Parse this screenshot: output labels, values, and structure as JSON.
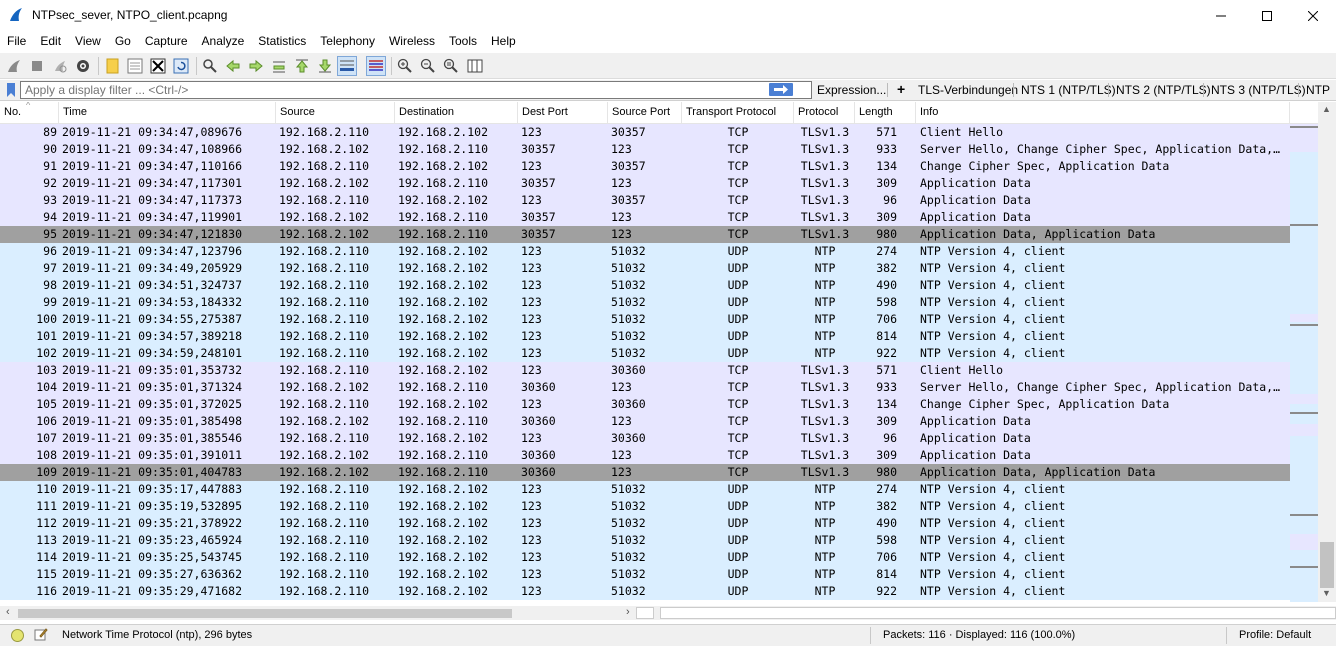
{
  "window": {
    "title": "NTPsec_sever, NTPO_client.pcapng"
  },
  "menu": [
    "File",
    "Edit",
    "View",
    "Go",
    "Capture",
    "Analyze",
    "Statistics",
    "Telephony",
    "Wireless",
    "Tools",
    "Help"
  ],
  "filter": {
    "placeholder": "Apply a display filter ... <Ctrl-/>",
    "expression_label": "Expression...",
    "buttons": [
      "TLS-Verbindungen",
      "NTS 1 (NTP/TLS)",
      "NTS 2 (NTP/TLS)",
      "NTS 3 (NTP/TLS)",
      "NTP"
    ]
  },
  "columns": [
    "No.",
    "Time",
    "Source",
    "Destination",
    "Dest Port",
    "Source Port",
    "Transport Protocol",
    "Protocol",
    "Length",
    "Info"
  ],
  "packets": [
    {
      "no": "89",
      "time": "2019-11-21 09:34:47,089676",
      "src": "192.168.2.110",
      "dst": "192.168.2.102",
      "dport": "123",
      "sport": "30357",
      "tproto": "TCP",
      "proto": "TLSv1.3",
      "len": "571",
      "info": "Client Hello",
      "kind": "tcp"
    },
    {
      "no": "90",
      "time": "2019-11-21 09:34:47,108966",
      "src": "192.168.2.102",
      "dst": "192.168.2.110",
      "dport": "30357",
      "sport": "123",
      "tproto": "TCP",
      "proto": "TLSv1.3",
      "len": "933",
      "info": "Server Hello, Change Cipher Spec, Application Data,…",
      "kind": "tcp"
    },
    {
      "no": "91",
      "time": "2019-11-21 09:34:47,110166",
      "src": "192.168.2.110",
      "dst": "192.168.2.102",
      "dport": "123",
      "sport": "30357",
      "tproto": "TCP",
      "proto": "TLSv1.3",
      "len": "134",
      "info": "Change Cipher Spec, Application Data",
      "kind": "tcp"
    },
    {
      "no": "92",
      "time": "2019-11-21 09:34:47,117301",
      "src": "192.168.2.102",
      "dst": "192.168.2.110",
      "dport": "30357",
      "sport": "123",
      "tproto": "TCP",
      "proto": "TLSv1.3",
      "len": "309",
      "info": "Application Data",
      "kind": "tcp"
    },
    {
      "no": "93",
      "time": "2019-11-21 09:34:47,117373",
      "src": "192.168.2.110",
      "dst": "192.168.2.102",
      "dport": "123",
      "sport": "30357",
      "tproto": "TCP",
      "proto": "TLSv1.3",
      "len": "96",
      "info": "Application Data",
      "kind": "tcp"
    },
    {
      "no": "94",
      "time": "2019-11-21 09:34:47,119901",
      "src": "192.168.2.102",
      "dst": "192.168.2.110",
      "dport": "30357",
      "sport": "123",
      "tproto": "TCP",
      "proto": "TLSv1.3",
      "len": "309",
      "info": "Application Data",
      "kind": "tcp"
    },
    {
      "no": "95",
      "time": "2019-11-21 09:34:47,121830",
      "src": "192.168.2.102",
      "dst": "192.168.2.110",
      "dport": "30357",
      "sport": "123",
      "tproto": "TCP",
      "proto": "TLSv1.3",
      "len": "980",
      "info": "Application Data, Application Data",
      "kind": "sel"
    },
    {
      "no": "96",
      "time": "2019-11-21 09:34:47,123796",
      "src": "192.168.2.110",
      "dst": "192.168.2.102",
      "dport": "123",
      "sport": "51032",
      "tproto": "UDP",
      "proto": "NTP",
      "len": "274",
      "info": "NTP Version 4, client",
      "kind": "udp"
    },
    {
      "no": "97",
      "time": "2019-11-21 09:34:49,205929",
      "src": "192.168.2.110",
      "dst": "192.168.2.102",
      "dport": "123",
      "sport": "51032",
      "tproto": "UDP",
      "proto": "NTP",
      "len": "382",
      "info": "NTP Version 4, client",
      "kind": "udp"
    },
    {
      "no": "98",
      "time": "2019-11-21 09:34:51,324737",
      "src": "192.168.2.110",
      "dst": "192.168.2.102",
      "dport": "123",
      "sport": "51032",
      "tproto": "UDP",
      "proto": "NTP",
      "len": "490",
      "info": "NTP Version 4, client",
      "kind": "udp"
    },
    {
      "no": "99",
      "time": "2019-11-21 09:34:53,184332",
      "src": "192.168.2.110",
      "dst": "192.168.2.102",
      "dport": "123",
      "sport": "51032",
      "tproto": "UDP",
      "proto": "NTP",
      "len": "598",
      "info": "NTP Version 4, client",
      "kind": "udp"
    },
    {
      "no": "100",
      "time": "2019-11-21 09:34:55,275387",
      "src": "192.168.2.110",
      "dst": "192.168.2.102",
      "dport": "123",
      "sport": "51032",
      "tproto": "UDP",
      "proto": "NTP",
      "len": "706",
      "info": "NTP Version 4, client",
      "kind": "udp"
    },
    {
      "no": "101",
      "time": "2019-11-21 09:34:57,389218",
      "src": "192.168.2.110",
      "dst": "192.168.2.102",
      "dport": "123",
      "sport": "51032",
      "tproto": "UDP",
      "proto": "NTP",
      "len": "814",
      "info": "NTP Version 4, client",
      "kind": "udp"
    },
    {
      "no": "102",
      "time": "2019-11-21 09:34:59,248101",
      "src": "192.168.2.110",
      "dst": "192.168.2.102",
      "dport": "123",
      "sport": "51032",
      "tproto": "UDP",
      "proto": "NTP",
      "len": "922",
      "info": "NTP Version 4, client",
      "kind": "udp"
    },
    {
      "no": "103",
      "time": "2019-11-21 09:35:01,353732",
      "src": "192.168.2.110",
      "dst": "192.168.2.102",
      "dport": "123",
      "sport": "30360",
      "tproto": "TCP",
      "proto": "TLSv1.3",
      "len": "571",
      "info": "Client Hello",
      "kind": "tcp"
    },
    {
      "no": "104",
      "time": "2019-11-21 09:35:01,371324",
      "src": "192.168.2.102",
      "dst": "192.168.2.110",
      "dport": "30360",
      "sport": "123",
      "tproto": "TCP",
      "proto": "TLSv1.3",
      "len": "933",
      "info": "Server Hello, Change Cipher Spec, Application Data,…",
      "kind": "tcp"
    },
    {
      "no": "105",
      "time": "2019-11-21 09:35:01,372025",
      "src": "192.168.2.110",
      "dst": "192.168.2.102",
      "dport": "123",
      "sport": "30360",
      "tproto": "TCP",
      "proto": "TLSv1.3",
      "len": "134",
      "info": "Change Cipher Spec, Application Data",
      "kind": "tcp"
    },
    {
      "no": "106",
      "time": "2019-11-21 09:35:01,385498",
      "src": "192.168.2.102",
      "dst": "192.168.2.110",
      "dport": "30360",
      "sport": "123",
      "tproto": "TCP",
      "proto": "TLSv1.3",
      "len": "309",
      "info": "Application Data",
      "kind": "tcp"
    },
    {
      "no": "107",
      "time": "2019-11-21 09:35:01,385546",
      "src": "192.168.2.110",
      "dst": "192.168.2.102",
      "dport": "123",
      "sport": "30360",
      "tproto": "TCP",
      "proto": "TLSv1.3",
      "len": "96",
      "info": "Application Data",
      "kind": "tcp"
    },
    {
      "no": "108",
      "time": "2019-11-21 09:35:01,391011",
      "src": "192.168.2.102",
      "dst": "192.168.2.110",
      "dport": "30360",
      "sport": "123",
      "tproto": "TCP",
      "proto": "TLSv1.3",
      "len": "309",
      "info": "Application Data",
      "kind": "tcp"
    },
    {
      "no": "109",
      "time": "2019-11-21 09:35:01,404783",
      "src": "192.168.2.102",
      "dst": "192.168.2.110",
      "dport": "30360",
      "sport": "123",
      "tproto": "TCP",
      "proto": "TLSv1.3",
      "len": "980",
      "info": "Application Data, Application Data",
      "kind": "sel"
    },
    {
      "no": "110",
      "time": "2019-11-21 09:35:17,447883",
      "src": "192.168.2.110",
      "dst": "192.168.2.102",
      "dport": "123",
      "sport": "51032",
      "tproto": "UDP",
      "proto": "NTP",
      "len": "274",
      "info": "NTP Version 4, client",
      "kind": "udp"
    },
    {
      "no": "111",
      "time": "2019-11-21 09:35:19,532895",
      "src": "192.168.2.110",
      "dst": "192.168.2.102",
      "dport": "123",
      "sport": "51032",
      "tproto": "UDP",
      "proto": "NTP",
      "len": "382",
      "info": "NTP Version 4, client",
      "kind": "udp"
    },
    {
      "no": "112",
      "time": "2019-11-21 09:35:21,378922",
      "src": "192.168.2.110",
      "dst": "192.168.2.102",
      "dport": "123",
      "sport": "51032",
      "tproto": "UDP",
      "proto": "NTP",
      "len": "490",
      "info": "NTP Version 4, client",
      "kind": "udp"
    },
    {
      "no": "113",
      "time": "2019-11-21 09:35:23,465924",
      "src": "192.168.2.110",
      "dst": "192.168.2.102",
      "dport": "123",
      "sport": "51032",
      "tproto": "UDP",
      "proto": "NTP",
      "len": "598",
      "info": "NTP Version 4, client",
      "kind": "udp"
    },
    {
      "no": "114",
      "time": "2019-11-21 09:35:25,543745",
      "src": "192.168.2.110",
      "dst": "192.168.2.102",
      "dport": "123",
      "sport": "51032",
      "tproto": "UDP",
      "proto": "NTP",
      "len": "706",
      "info": "NTP Version 4, client",
      "kind": "udp"
    },
    {
      "no": "115",
      "time": "2019-11-21 09:35:27,636362",
      "src": "192.168.2.110",
      "dst": "192.168.2.102",
      "dport": "123",
      "sport": "51032",
      "tproto": "UDP",
      "proto": "NTP",
      "len": "814",
      "info": "NTP Version 4, client",
      "kind": "udp"
    },
    {
      "no": "116",
      "time": "2019-11-21 09:35:29,471682",
      "src": "192.168.2.110",
      "dst": "192.168.2.102",
      "dport": "123",
      "sport": "51032",
      "tproto": "UDP",
      "proto": "NTP",
      "len": "922",
      "info": "NTP Version 4, client",
      "kind": "udp"
    }
  ],
  "status": {
    "text": "Network Time Protocol (ntp), 296 bytes",
    "packets": "Packets: 116 · Displayed: 116 (100.0%)",
    "profile": "Profile: Default"
  },
  "colors": {
    "tcp_row": "#e7e6ff",
    "udp_row": "#daeeff",
    "selected_row": "#a0a0a0",
    "accent": "#4a7fd4"
  },
  "icons": {
    "toolbar": [
      "shark-fin-start-icon",
      "stop-icon",
      "restart-icon",
      "options-gear-icon",
      "open-file-icon",
      "save-file-icon",
      "close-file-icon",
      "reload-icon",
      "find-icon",
      "go-back-icon",
      "go-forward-icon",
      "go-to-packet-icon",
      "go-first-icon",
      "go-last-icon",
      "autoscroll-icon",
      "colorize-icon",
      "zoom-in-icon",
      "zoom-out-icon",
      "zoom-normal-icon",
      "resize-columns-icon"
    ]
  }
}
